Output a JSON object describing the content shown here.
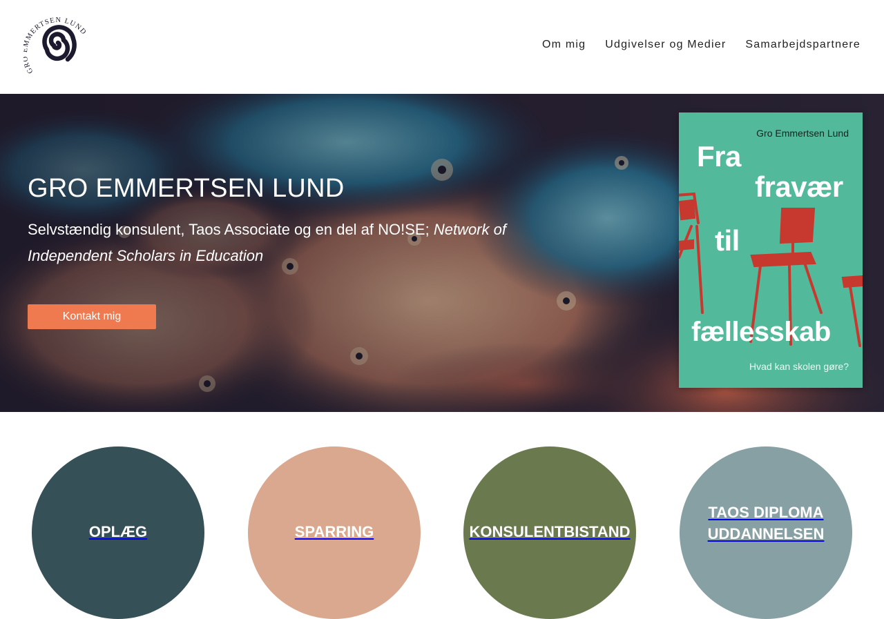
{
  "logo": {
    "text": "GRO EMMERTSEN LUND",
    "icon": "spiral-icon"
  },
  "nav": {
    "items": [
      "Om mig",
      "Udgivelser og Medier",
      "Samarbejdspartnere"
    ]
  },
  "hero": {
    "title": "GRO EMMERTSEN LUND",
    "subtitle_plain": "Selvstændig konsulent, Taos Associate og en del af NO!SE; ",
    "subtitle_italic": "Network of Independent Scholars in Education",
    "cta_label": "Kontakt mig"
  },
  "book": {
    "author": "Gro Emmertsen Lund",
    "title_words": [
      "Fra",
      "fravær",
      "til",
      "fællesskab"
    ],
    "tagline": "Hvad kan skolen gøre?",
    "cover_color": "#52b99b",
    "chair_color": "#c7392f"
  },
  "services": [
    {
      "label": "OPLÆG",
      "color": "#365058"
    },
    {
      "label": "SPARRING",
      "color": "#d9a88e"
    },
    {
      "label": "KONSULENTBISTAND",
      "color": "#6a7a4e"
    },
    {
      "label": "TAOS DIPLOMA UDDANNELSEN",
      "color": "#87a0a4"
    }
  ],
  "colors": {
    "accent": "#ef7a50"
  }
}
